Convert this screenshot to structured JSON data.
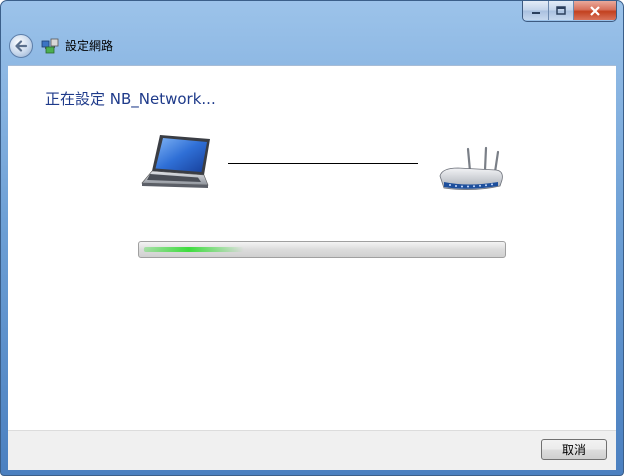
{
  "window": {
    "title": "設定網路",
    "caption_buttons": [
      "minimize-icon",
      "maximize-icon",
      "close-icon"
    ]
  },
  "nav": {
    "back_icon": "back-arrow-icon"
  },
  "main": {
    "heading": "正在設定 NB_Network...",
    "devices": [
      "laptop-icon",
      "router-icon"
    ],
    "progress": {
      "indeterminate": true,
      "glow_position_fraction": 0.15
    }
  },
  "footer": {
    "cancel_label": "取消"
  },
  "colors": {
    "heading": "#1e3a8a",
    "progress_glow": "#3ddc3d",
    "close_button": "#c2411f"
  }
}
